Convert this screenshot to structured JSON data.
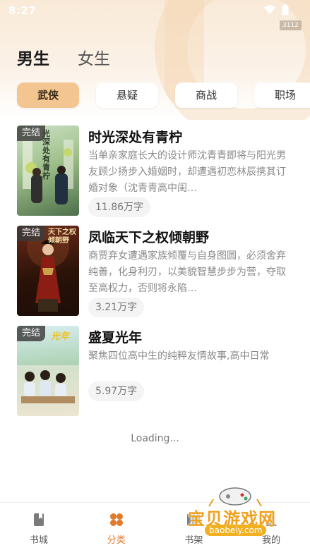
{
  "status_bar": {
    "time": "8:27",
    "tag": "3112"
  },
  "gender_tabs": [
    {
      "label": "男生",
      "active": true
    },
    {
      "label": "女生",
      "active": false
    }
  ],
  "categories": [
    {
      "label": "武侠",
      "active": true
    },
    {
      "label": "悬疑",
      "active": false
    },
    {
      "label": "商战",
      "active": false
    },
    {
      "label": "职场",
      "active": false
    }
  ],
  "books": [
    {
      "badge": "完结",
      "title": "时光深处有青柠",
      "desc": "当单亲家庭长大的设计师沈青青即将与阳光男友顾少扬步入婚姻时，却遭遇初恋林辰携其订婚对象（沈青青高中闺…",
      "words": "11.86万字",
      "cover_text": "光深处有青柠"
    },
    {
      "badge": "完结",
      "title": "凤临天下之权倾朝野",
      "desc": "商贾弃女遭遇家族倾覆与自身图圆，必须舍弃纯善，化身利刃，以美貌智慧步步为营，夺取至高权力，否则将永陷…",
      "words": "3.21万字",
      "cover_text": "天下之权倾朝野"
    },
    {
      "badge": "完结",
      "title": "盛夏光年",
      "desc": "聚焦四位高中生的纯粹友情故事,高中日常",
      "words": "5.97万字",
      "cover_text": "光年"
    }
  ],
  "loading_text": "Loading...",
  "bottom_nav": [
    {
      "label": "书城",
      "icon": "book-icon",
      "active": false
    },
    {
      "label": "分类",
      "icon": "category-icon",
      "active": true
    },
    {
      "label": "书架",
      "icon": "shelf-icon",
      "active": false
    },
    {
      "label": "我的",
      "icon": "profile-icon",
      "active": false
    }
  ],
  "watermark": {
    "name": "宝贝游戏网",
    "url": "baobeiy.com"
  },
  "colors": {
    "accent": "#e07a2c",
    "chip_active": "#f3c691",
    "tab_underline": "#f2b775",
    "header_bg": "#f9ead8"
  }
}
